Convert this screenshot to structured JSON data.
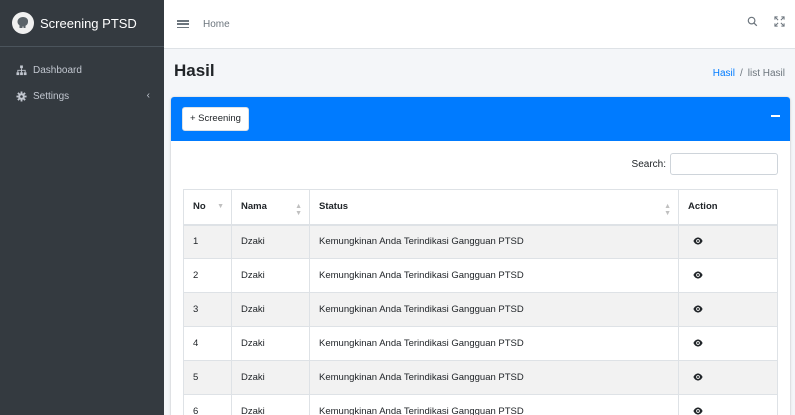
{
  "brand": {
    "name": "Screening PTSD",
    "logo_icon": "brain-logo-icon"
  },
  "sidebar": {
    "items": [
      {
        "label": "Dashboard",
        "icon": "sitemap-icon"
      },
      {
        "label": "Settings",
        "icon": "cog-icon",
        "chevron": "‹"
      }
    ]
  },
  "topbar": {
    "home": "Home",
    "icons": [
      "search-icon",
      "fullscreen-icon"
    ]
  },
  "page": {
    "title": "Hasil"
  },
  "breadcrumb": {
    "link": "Hasil",
    "separator": "/",
    "current": "list Hasil"
  },
  "card": {
    "add_button": "+ Screening",
    "header_color": "#007bff",
    "search_label": "Search:",
    "search_value": ""
  },
  "table": {
    "columns": [
      "No",
      "Nama",
      "Status",
      "Action"
    ],
    "rows": [
      {
        "no": "1",
        "nama": "Dzaki",
        "status": "Kemungkinan Anda Terindikasi Gangguan PTSD",
        "action_icon": "eye-icon"
      },
      {
        "no": "2",
        "nama": "Dzaki",
        "status": "Kemungkinan Anda Terindikasi Gangguan PTSD",
        "action_icon": "eye-icon"
      },
      {
        "no": "3",
        "nama": "Dzaki",
        "status": "Kemungkinan Anda Terindikasi Gangguan PTSD",
        "action_icon": "eye-icon"
      },
      {
        "no": "4",
        "nama": "Dzaki",
        "status": "Kemungkinan Anda Terindikasi Gangguan PTSD",
        "action_icon": "eye-icon"
      },
      {
        "no": "5",
        "nama": "Dzaki",
        "status": "Kemungkinan Anda Terindikasi Gangguan PTSD",
        "action_icon": "eye-icon"
      },
      {
        "no": "6",
        "nama": "Dzaki",
        "status": "Kemungkinan Anda Terindikasi Gangguan PTSD",
        "action_icon": "eye-icon"
      }
    ]
  }
}
